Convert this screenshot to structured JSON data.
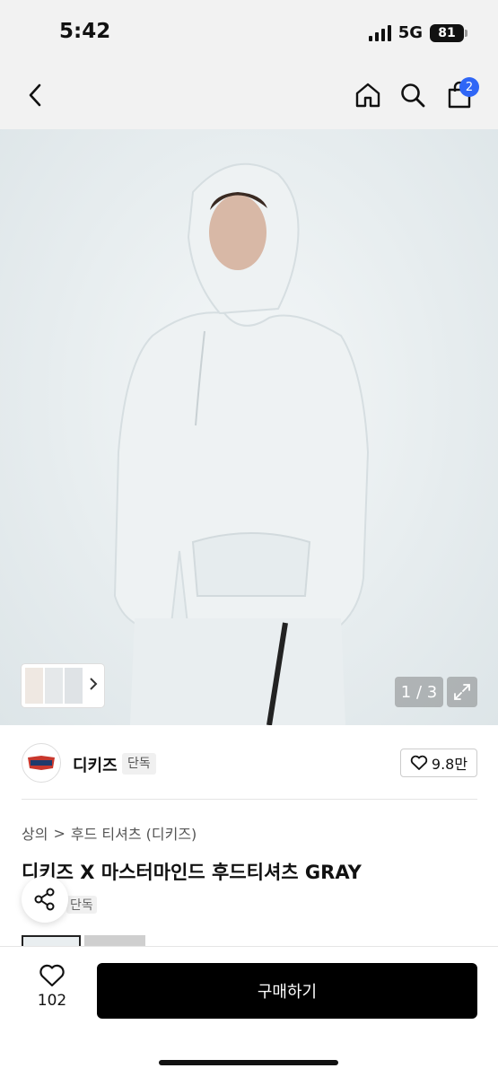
{
  "status": {
    "time": "5:42",
    "network": "5G",
    "battery": "81"
  },
  "nav": {
    "cart_count": "2",
    "icons": [
      "back-icon",
      "home-icon",
      "search-icon",
      "cart-icon"
    ]
  },
  "gallery": {
    "page": "1 / 3"
  },
  "brand": {
    "name": "디키즈",
    "exclusive": "단독",
    "likes": "9.8만",
    "logo_text": "Dickies"
  },
  "breadcrumb": {
    "category": "상의",
    "separator": ">",
    "subcategory": "후드 티셔츠 (디키즈)"
  },
  "product": {
    "title": "디키즈 X 마스터마인드 후드티셔츠 GRAY",
    "badge": "단독"
  },
  "bottom": {
    "wish_count": "102",
    "buy_label": "구매하기"
  },
  "colors": {
    "accent": "#2f66f6",
    "buy_button": "#000000"
  }
}
